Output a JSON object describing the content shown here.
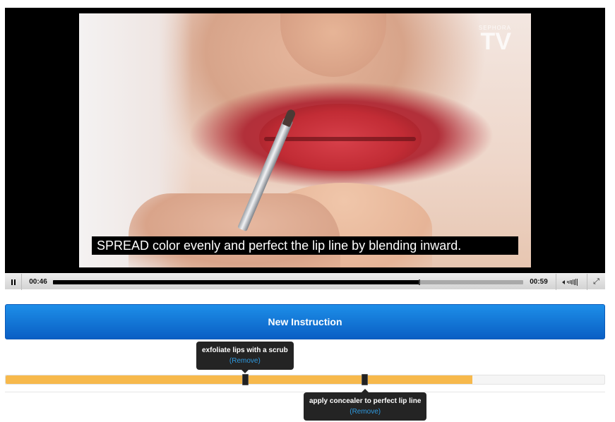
{
  "video": {
    "logo_brand": "SEPHORA",
    "logo_tv": "TV",
    "caption": "SPREAD color evenly and perfect the lip line by blending inward."
  },
  "controls": {
    "elapsed": "00:46",
    "total": "00:59",
    "progress": 0.78
  },
  "new_instruction_button": "New Instruction",
  "timeline": {
    "fill_fraction": 0.78,
    "markers": [
      {
        "label": "exfoliate lips with a scrub",
        "remove": "(Remove)",
        "fraction": 0.4
      },
      {
        "label": "apply concealer to perfect lip line",
        "remove": "(Remove)",
        "fraction": 0.6
      }
    ]
  },
  "colors": {
    "button_blue": "#0a5fc4",
    "timeline_fill": "#f7b94c",
    "link_blue": "#2f9ae0"
  }
}
